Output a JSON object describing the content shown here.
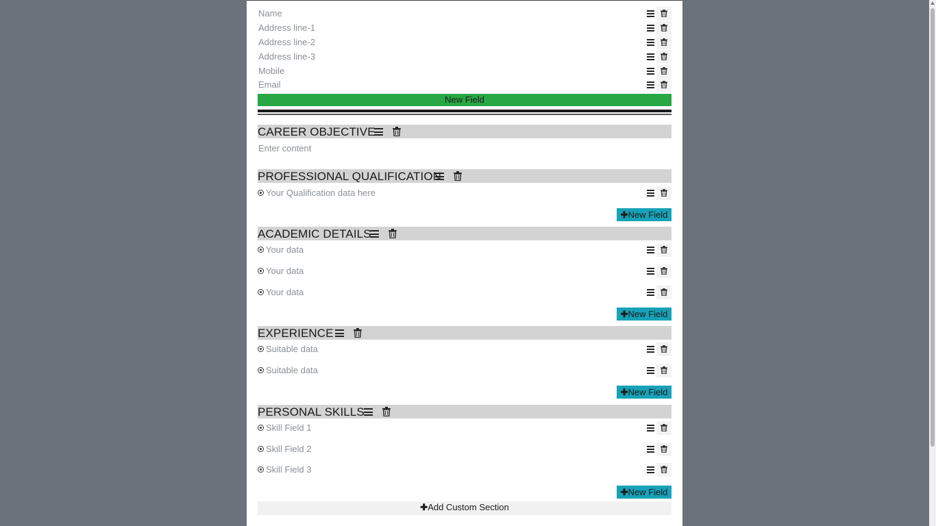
{
  "header_fields": [
    {
      "placeholder": "Name"
    },
    {
      "placeholder": "Address line-1"
    },
    {
      "placeholder": "Address line-2"
    },
    {
      "placeholder": "Address line-3"
    },
    {
      "placeholder": "Mobile"
    },
    {
      "placeholder": "Email"
    }
  ],
  "header_new_field_label": "New Field",
  "career": {
    "title": "CAREER OBJECTIVE",
    "content_placeholder": "Enter content"
  },
  "professional": {
    "title": "PROFESSIONAL QUALIFICATION",
    "fields": [
      "Your Qualification data here"
    ],
    "new_field_label": "New Field"
  },
  "academic": {
    "title": "ACADEMIC DETAILS",
    "fields": [
      "Your data",
      "Your data",
      "Your data"
    ],
    "new_field_label": "New Field"
  },
  "experience": {
    "title": "EXPERIENCE",
    "fields": [
      "Suitable data",
      "Suitable data"
    ],
    "new_field_label": "New Field"
  },
  "skills": {
    "title": "PERSONAL SKILLS",
    "fields": [
      "Skill Field 1",
      "Skill Field 2",
      "Skill Field 3"
    ],
    "new_field_label": "New Field"
  },
  "add_custom_section_label": "Add Custom Section",
  "colors": {
    "page_bg": "#6c727c",
    "green": "#28a745",
    "teal": "#17a2b8",
    "section_head_bg": "#d3d3d3"
  },
  "icons": {
    "reorder": "hamburger-icon",
    "delete": "trash-icon",
    "bullet": "bullet-icon",
    "plus": "plus-icon"
  }
}
